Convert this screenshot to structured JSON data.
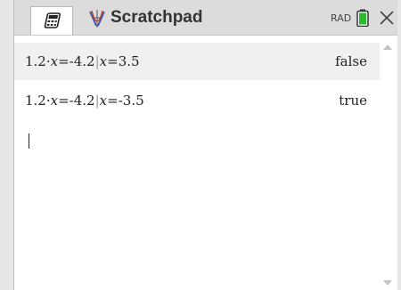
{
  "app": {
    "title": "Scratchpad",
    "angle_mode": "RAD",
    "icons": [
      "calculator-icon",
      "graph-icon",
      "battery-icon",
      "close-icon"
    ]
  },
  "history": [
    {
      "coef": "1.2",
      "dot": "·",
      "var": "x",
      "eq_value": "=-4.2",
      "bar": "|",
      "cond_var": "x",
      "cond_value": "=3.5",
      "result": "false"
    },
    {
      "coef": "1.2",
      "dot": "·",
      "var": "x",
      "eq_value": "=-4.2",
      "bar": "|",
      "cond_var": "x",
      "cond_value": "=-3.5",
      "result": "true"
    }
  ],
  "colors": {
    "battery": "#2db82d",
    "titlebar": "#dcdcdc"
  }
}
